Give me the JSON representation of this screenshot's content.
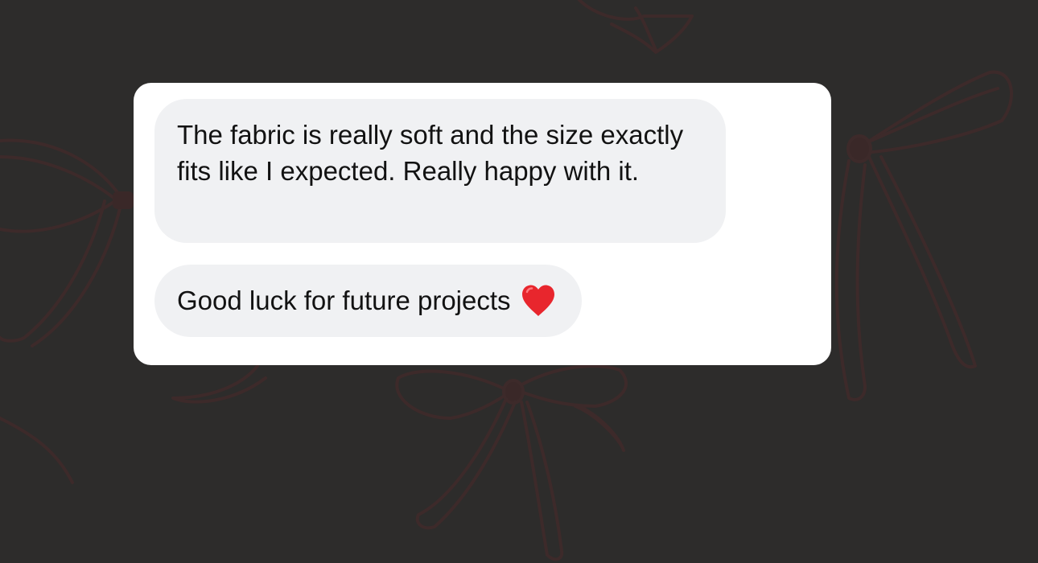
{
  "background": {
    "color": "#2d2c2b",
    "pattern": "ribbon-bows"
  },
  "card": {
    "background": "#ffffff"
  },
  "messages": [
    {
      "text": "The fabric is really soft and the size exactly fits like I expected. Really happy with it."
    },
    {
      "text": "Good luck for future projects",
      "emoji": "red-heart-icon"
    }
  ],
  "colors": {
    "bubble": "#f0f1f3",
    "text": "#121212",
    "heart": "#e8262d"
  }
}
